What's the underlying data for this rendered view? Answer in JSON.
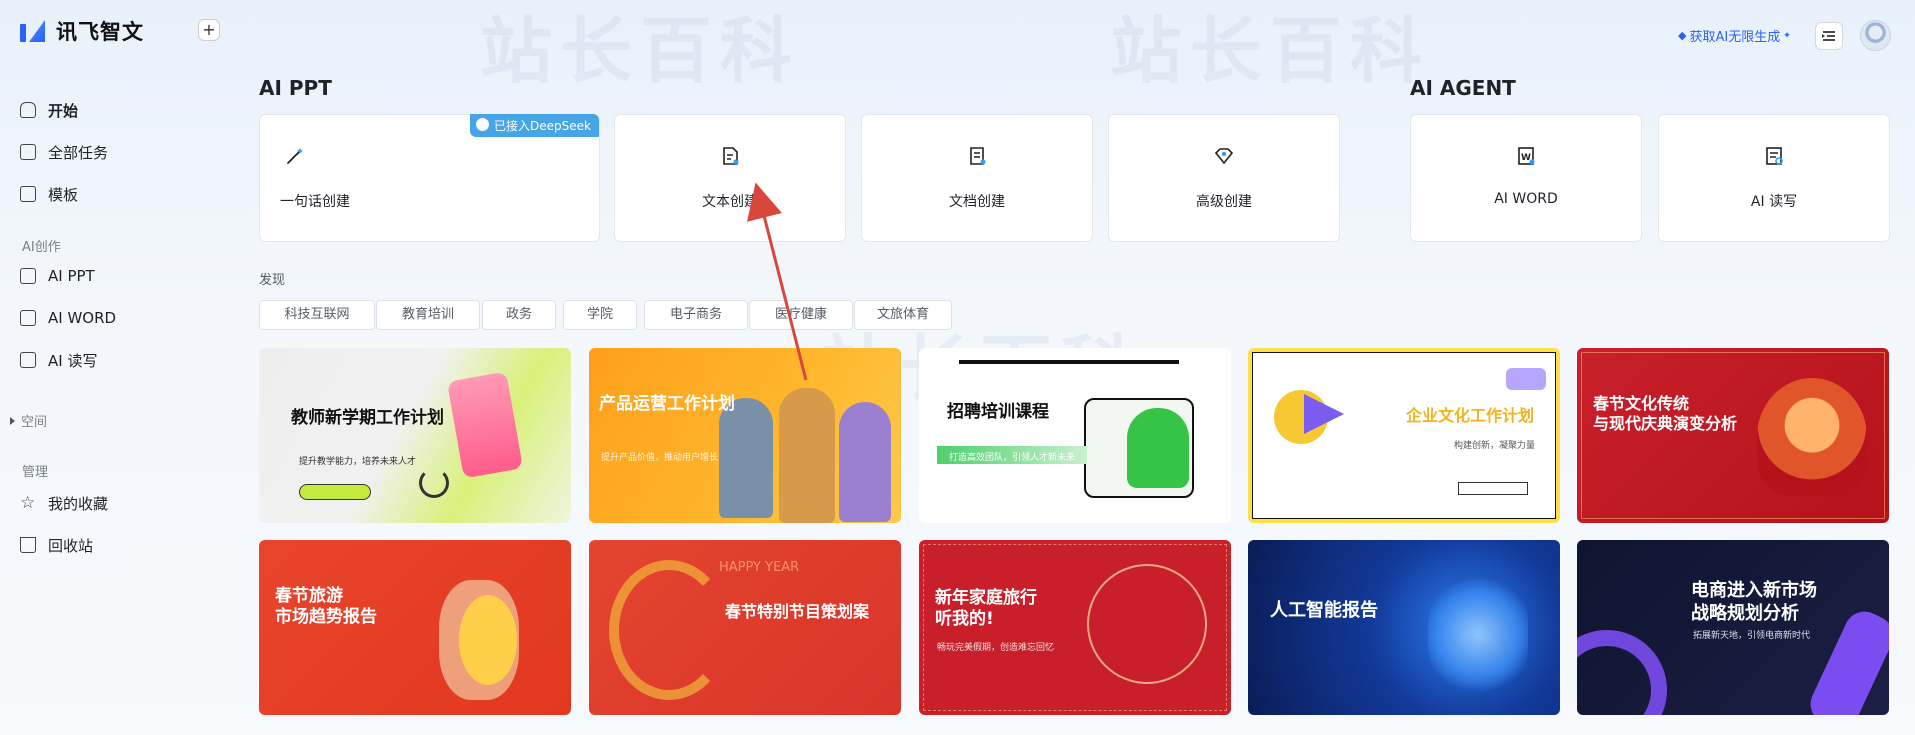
{
  "app": {
    "name": "讯飞智文"
  },
  "header": {
    "get_ai": "获取AI无限生成"
  },
  "sidebar": {
    "start": "开始",
    "all_tasks": "全部任务",
    "templates": "模板",
    "ai_section": "AI创作",
    "ai_ppt": "AI PPT",
    "ai_word": "AI WORD",
    "ai_read": "AI 读写",
    "space": "空间",
    "manage_section": "管理",
    "favorites": "我的收藏",
    "recycle": "回收站"
  },
  "ai_ppt": {
    "title": "AI PPT",
    "badge": "已接入DeepSeek",
    "cards": [
      "一句话创建",
      "文本创建",
      "文档创建",
      "高级创建"
    ]
  },
  "ai_agent": {
    "title": "AI AGENT",
    "cards": [
      "AI WORD",
      "AI 读写"
    ]
  },
  "discover": {
    "title": "发现",
    "chips": [
      "科技互联网",
      "教育培训",
      "政务",
      "学院",
      "电子商务",
      "医疗健康",
      "文旅体育"
    ]
  },
  "templates": [
    {
      "title": "教师新学期工作计划",
      "sub": "提升教学能力，培养未来人才"
    },
    {
      "title": "产品运营工作计划",
      "sub": "提升产品价值，推动用户增长"
    },
    {
      "title": "招聘培训课程",
      "sub": "打造高效团队，引领人才新未来"
    },
    {
      "title": "企业文化工作计划",
      "sub": "构建创新，凝聚力量"
    },
    {
      "title": "春节文化传统\n与现代庆典演变分析",
      "sub": ""
    },
    {
      "title": "春节旅游\n市场趋势报告",
      "sub": ""
    },
    {
      "title": "春节特别节目策划案",
      "sub": "HAPPY YEAR"
    },
    {
      "title": "新年家庭旅行\n听我的!",
      "sub": "畅玩完美假期，创造难忘回忆"
    },
    {
      "title": "人工智能报告",
      "sub": ""
    },
    {
      "title": "电商进入新市场\n战略规划分析",
      "sub": "拓展新天地，引领电商新时代"
    }
  ],
  "colors": {
    "accent": "#2a63f5",
    "badge": "#45a5e6",
    "arrow": "#d9473c"
  }
}
